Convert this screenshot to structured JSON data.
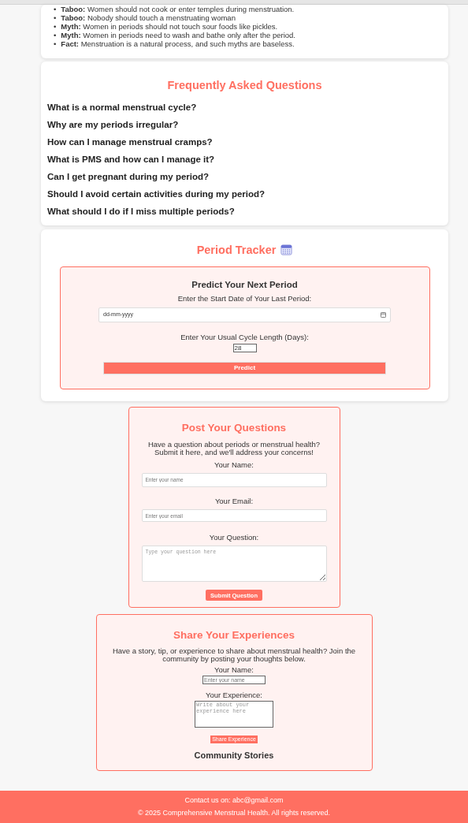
{
  "myths": [
    {
      "marker": "•",
      "text": "**Taboo:** Women should not cook or enter temples during menstruation."
    },
    {
      "marker": "•",
      "text": "**Taboo:** Nobody should touch a menstruating woman"
    },
    {
      "marker": "•",
      "text": "**Myth:** Women in periods should not touch sour foods like pickles."
    },
    {
      "marker": "•",
      "text": "**Myth:** Women in periods need to wash and bathe only after the period."
    },
    {
      "marker": "•",
      "text": "**Fact:** Menstruation is a natural process, and such myths are baseless."
    }
  ],
  "faq": {
    "title": "Frequently Asked Questions",
    "questions": [
      "What is a normal menstrual cycle?",
      "Why are my periods irregular?",
      "How can I manage menstrual cramps?",
      "What is PMS and how can I manage it?",
      "Can I get pregnant during my period?",
      "Should I avoid certain activities during my period?",
      "What should I do if I miss multiple periods?"
    ]
  },
  "tracker": {
    "title": "Period Tracker",
    "subtitle": "Predict Your Next Period",
    "date_label": "Enter the Start Date of Your Last Period:",
    "date_placeholder": "dd-mm-yyyy",
    "cycle_label": "Enter Your Usual Cycle Length (Days):",
    "cycle_value": "28",
    "button": "Predict"
  },
  "questions_form": {
    "title": "Post Your Questions",
    "intro": "Have a question about periods or menstrual health? Submit it here, and we'll address your concerns!",
    "name_label": "Your Name:",
    "name_placeholder": "Enter your name",
    "email_label": "Your Email:",
    "email_placeholder": "Enter your email",
    "question_label": "Your Question:",
    "question_placeholder": "Type your question here",
    "button": "Submit Question"
  },
  "experiences": {
    "title": "Share Your Experiences",
    "intro": "Have a story, tip, or experience to share about menstrual health? Join the community by posting your thoughts below.",
    "name_label": "Your Name:",
    "name_placeholder": "Enter your name",
    "experience_label": "Your Experience:",
    "experience_placeholder": "Write about your experience here",
    "button": "Share Experience",
    "stories_title": "Community Stories"
  },
  "footer": {
    "contact": "Contact us on: abc@gmail.com",
    "copyright": "© 2025 Comprehensive Menstrual Health. All rights reserved."
  }
}
